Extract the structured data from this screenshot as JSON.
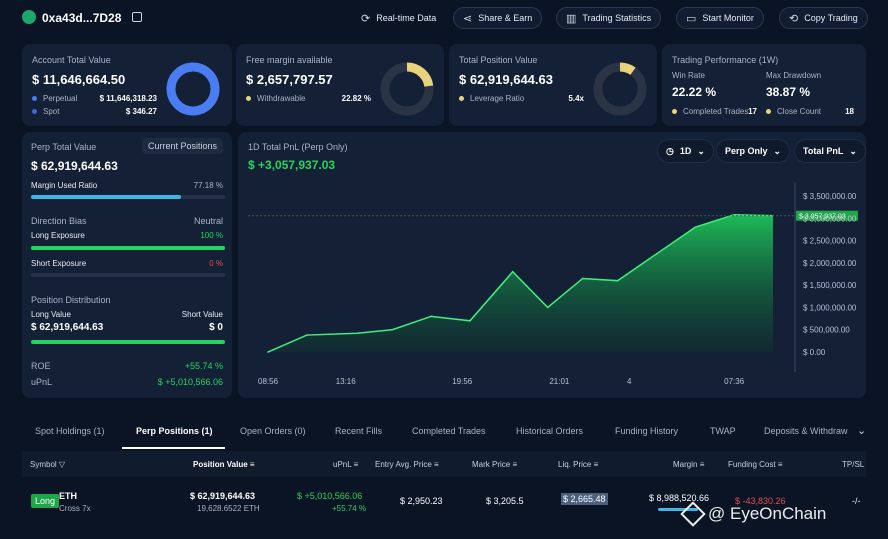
{
  "header": {
    "address": "0xa43d...7D28",
    "buttons": [
      "Real-time Data",
      "Share & Earn",
      "Trading Statistics",
      "Start Monitor",
      "Copy Trading"
    ]
  },
  "account": {
    "title": "Account Total Value",
    "value": "$ 11,646,664.50",
    "rows": [
      {
        "label": "Perpetual",
        "value": "$ 11,646,318.23"
      },
      {
        "label": "Spot",
        "value": "$ 346.27"
      }
    ]
  },
  "free_margin": {
    "title": "Free margin available",
    "value": "$ 2,657,797.57",
    "row_label": "Withdrawable",
    "row_value": "22.82 %",
    "donut_fraction": 0.2282
  },
  "total_position": {
    "title": "Total Position Value",
    "value": "$ 62,919,644.63",
    "row_label": "Leverage Ratio",
    "row_value": "5.4x",
    "donut_fraction": 0.1
  },
  "performance": {
    "title": "Trading Performance (1W)",
    "win_rate_label": "Win Rate",
    "win_rate": "22.22 %",
    "max_dd_label": "Max Drawdown",
    "max_dd": "38.87 %",
    "completed_label": "Completed Trades",
    "completed": "17",
    "close_label": "Close Count",
    "close": "18"
  },
  "perp": {
    "title": "Perp Total Value",
    "badge": "Current Positions",
    "value": "$ 62,919,644.63",
    "margin_label": "Margin Used Ratio",
    "margin_value": "77.18 %",
    "margin_fraction": 0.7718,
    "bias_label": "Direction Bias",
    "bias_value": "Neutral",
    "long_label": "Long Exposure",
    "long_value": "100 %",
    "long_fraction": 1.0,
    "short_label": "Short Exposure",
    "short_value": "0 %",
    "dist_label": "Position Distribution",
    "long_value_label": "Long Value",
    "short_value_label": "Short Value",
    "long_amount": "$ 62,919,644.63",
    "short_amount": "$ 0",
    "roe_label": "ROE",
    "roe_value": "+55.74 %",
    "upnl_label": "uPnL",
    "upnl_value": "$ +5,010,566.06"
  },
  "pnl_chart": {
    "title": "1D Total PnL (Perp Only)",
    "value": "$ +3,057,937.03",
    "dropdowns": [
      "1D",
      "Perp Only",
      "Total PnL"
    ]
  },
  "chart_data": {
    "type": "area",
    "title": "1D Total PnL (Perp Only)",
    "x": [
      0,
      1,
      2,
      3,
      4,
      5,
      6,
      7,
      8,
      9,
      10,
      11,
      12,
      13,
      14,
      15,
      16
    ],
    "values": [
      0,
      380000,
      420000,
      500000,
      800000,
      700000,
      1800000,
      1000000,
      1650000,
      1600000,
      2200000,
      2800000,
      3080000,
      3057937
    ],
    "x_index": [
      0,
      1,
      2.3,
      3.2,
      4.2,
      5.2,
      6.3,
      7.2,
      8.1,
      9.0,
      10.0,
      11.0,
      12.0,
      13.0
    ],
    "x_tick_labels": [
      "08:56",
      "13:16",
      "19:56",
      "21:01",
      "4",
      "07:36"
    ],
    "x_tick_index": [
      0,
      2,
      5,
      7.5,
      9.5,
      12
    ],
    "y_tick_labels": [
      "$ 3,500,000.00",
      "$ 3,000,000.00",
      "$ 2,500,000.00",
      "$ 2,000,000.00",
      "$ 1,500,000.00",
      "$ 1,000,000.00",
      "$ 500,000.00",
      "$ 0.00"
    ],
    "ylim": [
      0,
      3500000
    ],
    "current_label": "$ 3,057,937.03",
    "current_value": 3057937.03,
    "grid": false,
    "color": "#1fd65f"
  },
  "tabs": [
    "Spot Holdings (1)",
    "Perp Positions (1)",
    "Open Orders (0)",
    "Recent Fills",
    "Completed Trades",
    "Historical Orders",
    "Funding History",
    "TWAP",
    "Deposits & Withdraw"
  ],
  "table": {
    "headers": [
      "Symbol",
      "Position Value",
      "uPnL",
      "Entry Avg. Price",
      "Mark Price",
      "Liq. Price",
      "Margin",
      "Funding Cost",
      "TP/SL"
    ],
    "row": {
      "side": "Long",
      "symbol": "ETH",
      "mode": "Cross 7x",
      "position_value": "$ 62,919,644.63",
      "position_qty": "19,628.6522 ETH",
      "upnl": "$ +5,010,566.06",
      "upnl_pct": "+55.74 %",
      "entry": "$ 2,950.23",
      "mark": "$ 3,205.5",
      "liq": "$ 2,665.48",
      "margin": "$ 8,988,520.66",
      "funding": "$ -43,830.26",
      "tpsl": "-/-"
    }
  },
  "watermark": "@ EyeOnChain",
  "colors": {
    "accent_blue": "#4a7cf2",
    "green": "#1fd65f",
    "yellow": "#e8d27c",
    "red": "#e05050"
  }
}
